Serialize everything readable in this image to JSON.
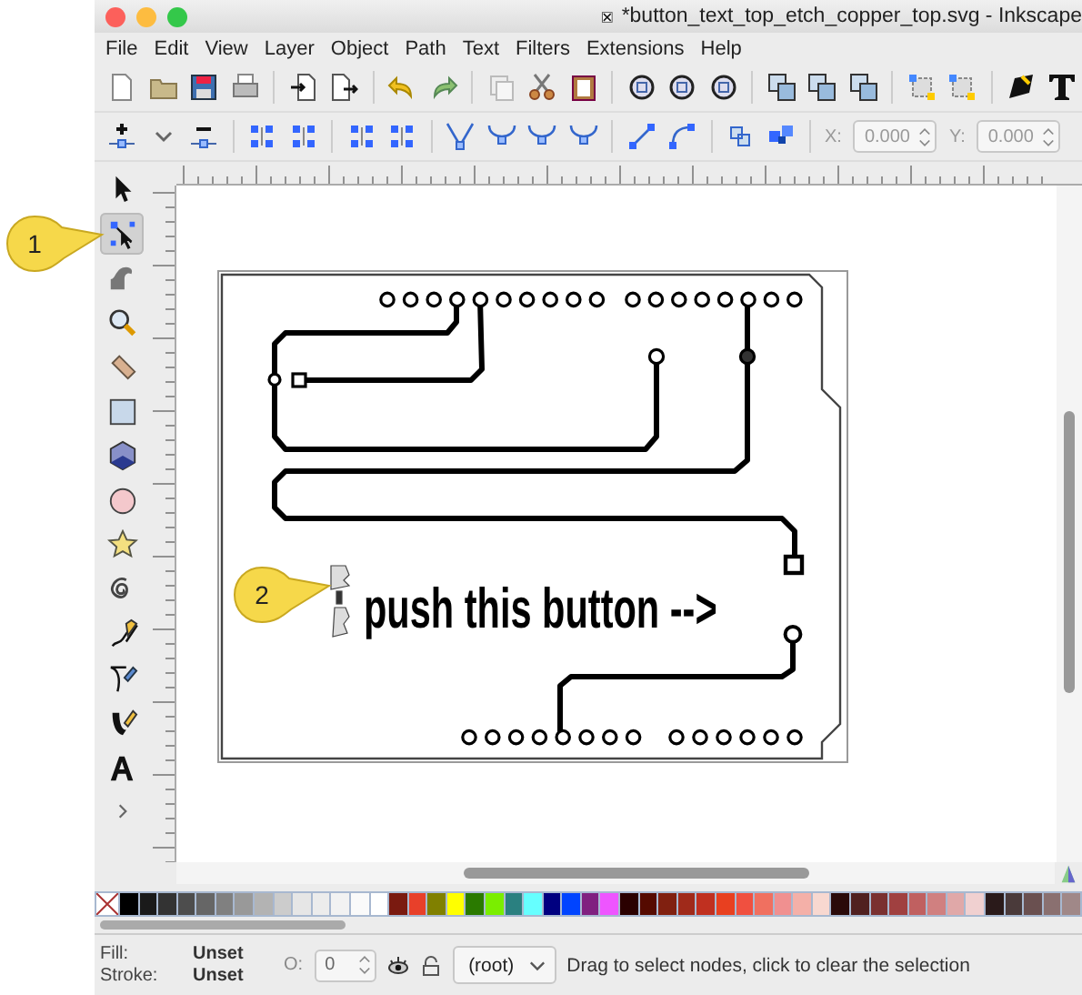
{
  "window": {
    "title": "*button_text_top_etch_copper_top.svg - Inkscape"
  },
  "menu": [
    "File",
    "Edit",
    "View",
    "Layer",
    "Object",
    "Path",
    "Text",
    "Filters",
    "Extensions",
    "Help"
  ],
  "coordinates": [
    {
      "label": "X:",
      "value": "0.000"
    },
    {
      "label": "Y:",
      "value": "0.000"
    }
  ],
  "toolbox": [
    {
      "kind": "selector",
      "selected": false
    },
    {
      "kind": "node",
      "selected": true
    },
    {
      "kind": "tweak",
      "selected": false
    },
    {
      "kind": "zoom",
      "selected": false
    },
    {
      "kind": "measure",
      "selected": false
    },
    {
      "kind": "rect",
      "selected": false
    },
    {
      "kind": "box3d",
      "selected": false
    },
    {
      "kind": "ellipse",
      "selected": false
    },
    {
      "kind": "star",
      "selected": false
    },
    {
      "kind": "spiral",
      "selected": false
    },
    {
      "kind": "pencil",
      "selected": false
    },
    {
      "kind": "pen",
      "selected": false
    },
    {
      "kind": "calligraphy",
      "selected": false
    },
    {
      "kind": "text",
      "selected": false
    }
  ],
  "canvas": {
    "text": "push this button -->"
  },
  "callouts": [
    {
      "label": "1"
    },
    {
      "label": "2"
    }
  ],
  "palette": [
    {
      "color": "#000000"
    },
    {
      "color": "#1a1a1a"
    },
    {
      "color": "#333333"
    },
    {
      "color": "#4d4d4d"
    },
    {
      "color": "#666666"
    },
    {
      "color": "#808080"
    },
    {
      "color": "#999999"
    },
    {
      "color": "#b3b3b3"
    },
    {
      "color": "#cccccc"
    },
    {
      "color": "#e6e6e6"
    },
    {
      "color": "#ececec"
    },
    {
      "color": "#f2f2f2"
    },
    {
      "color": "#fafafa"
    },
    {
      "color": "#ffffff"
    },
    {
      "color": "#7a1a10"
    },
    {
      "color": "#e8402a"
    },
    {
      "color": "#808000"
    },
    {
      "color": "#ffff00"
    },
    {
      "color": "#2a7a00"
    },
    {
      "color": "#7aee00"
    },
    {
      "color": "#2a8080"
    },
    {
      "color": "#66ffff"
    },
    {
      "color": "#000080"
    },
    {
      "color": "#0044ff"
    },
    {
      "color": "#802080"
    },
    {
      "color": "#ee55ff"
    },
    {
      "color": "#2a0000"
    },
    {
      "color": "#550a00"
    },
    {
      "color": "#802010"
    },
    {
      "color": "#a02a1a"
    },
    {
      "color": "#c03020"
    },
    {
      "color": "#e84020"
    },
    {
      "color": "#f05040"
    },
    {
      "color": "#f07060"
    },
    {
      "color": "#f09090"
    },
    {
      "color": "#f4b0a8"
    },
    {
      "color": "#f8d8d0"
    },
    {
      "color": "#2a0a0a"
    },
    {
      "color": "#502020"
    },
    {
      "color": "#7a3030"
    },
    {
      "color": "#a04040"
    },
    {
      "color": "#c06060"
    },
    {
      "color": "#d08080"
    },
    {
      "color": "#e0a8a8"
    },
    {
      "color": "#f0d0d0"
    },
    {
      "color": "#2a1a1a"
    },
    {
      "color": "#4a3a3a"
    },
    {
      "color": "#6a5050"
    },
    {
      "color": "#8a7070"
    },
    {
      "color": "#a08888"
    }
  ],
  "status_bar": {
    "fill_label": "Fill:",
    "fill_value": "Unset",
    "stroke_label": "Stroke:",
    "stroke_value": "Unset",
    "opacity_label": "O:",
    "opacity_value": "0",
    "layer": "(root)",
    "message": "Drag to select nodes, click to clear the selection"
  }
}
